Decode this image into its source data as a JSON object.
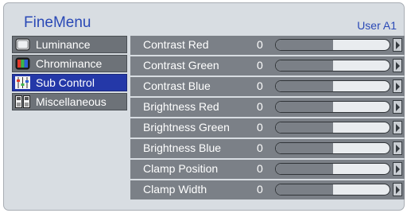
{
  "header": {
    "title": "FineMenu",
    "user": "User A1"
  },
  "sidebar": {
    "items": [
      {
        "label": "Luminance",
        "icon": "monitor-icon",
        "active": false
      },
      {
        "label": "Chrominance",
        "icon": "color-monitor-icon",
        "active": false
      },
      {
        "label": "Sub Control",
        "icon": "sliders-icon",
        "active": true
      },
      {
        "label": "Miscellaneous",
        "icon": "misc-grid-icon",
        "active": false
      }
    ]
  },
  "params": [
    {
      "label": "Contrast Red",
      "value": "0",
      "level": 0.5
    },
    {
      "label": "Contrast Green",
      "value": "0",
      "level": 0.5
    },
    {
      "label": "Contrast Blue",
      "value": "0",
      "level": 0.5
    },
    {
      "label": "Brightness Red",
      "value": "0",
      "level": 0.5
    },
    {
      "label": "Brightness Green",
      "value": "0",
      "level": 0.5
    },
    {
      "label": "Brightness Blue",
      "value": "0",
      "level": 0.5
    },
    {
      "label": "Clamp Position",
      "value": "0",
      "level": 0.5
    },
    {
      "label": "Clamp Width",
      "value": "0",
      "level": 0.5
    }
  ],
  "colors": {
    "accent": "#2438a8",
    "title": "#2a49b6",
    "row": "#7b8087",
    "panel": "#d8dde2"
  }
}
